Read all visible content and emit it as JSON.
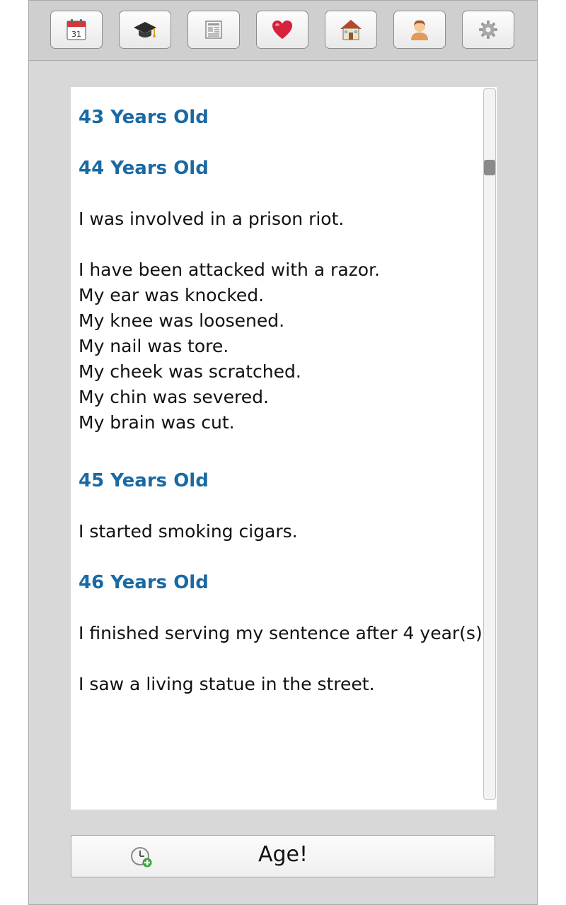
{
  "toolbar": {
    "buttons": [
      {
        "icon": "calendar-icon",
        "day": "31"
      },
      {
        "icon": "graduation-cap-icon"
      },
      {
        "icon": "newspaper-icon"
      },
      {
        "icon": "heart-icon"
      },
      {
        "icon": "house-icon"
      },
      {
        "icon": "person-icon"
      },
      {
        "icon": "gear-icon"
      }
    ]
  },
  "log": {
    "h43": "43 Years Old",
    "h44": "44 Years Old",
    "e44_1": "I was involved in a prison riot.",
    "e44_2": "I have been attacked with a razor.",
    "e44_3": "My ear was knocked.",
    "e44_4": "My knee was loosened.",
    "e44_5": "My nail was tore.",
    "e44_6": "My cheek was scratched.",
    "e44_7": "My chin was severed.",
    "e44_8": "My brain was cut.",
    "h45": "45 Years Old",
    "e45_1": "I started smoking cigars.",
    "h46": "46 Years Old",
    "e46_1": "I finished serving my sentence after 4 year(s).",
    "e46_2": "I saw a living statue in the street."
  },
  "age_button": {
    "label": "Age!",
    "icon": "clock-add-icon"
  },
  "colors": {
    "heading": "#1a69a4",
    "background": "#d8d8d8"
  }
}
